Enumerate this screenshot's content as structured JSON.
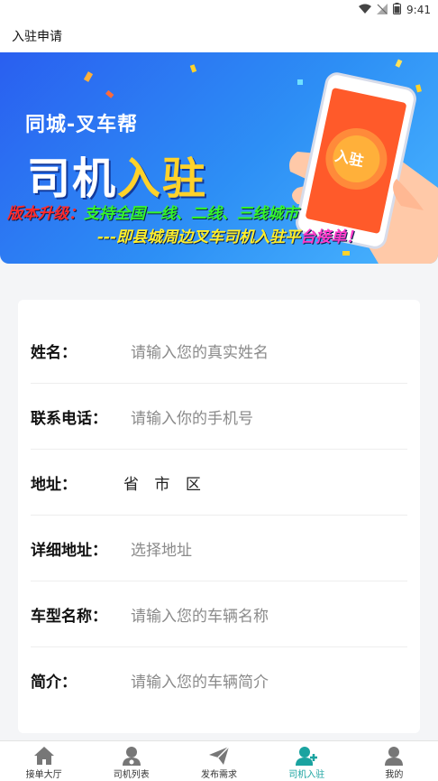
{
  "status_bar": {
    "time": "9:41"
  },
  "header": {
    "title": "入驻申请"
  },
  "banner": {
    "subtitle": "同城-叉车帮",
    "title_part1": "司机",
    "title_part2": "入驻",
    "line1_part1": "版本升级：",
    "line1_part2": "支持全国一线、二线、三线城市",
    "line2_part1": "---即县城周边叉车司机入驻平",
    "line2_part2": "台接单！",
    "phone_badge": "入驻"
  },
  "form": {
    "name": {
      "label": "姓名：",
      "placeholder": "请输入您的真实姓名"
    },
    "phone": {
      "label": "联系电话：",
      "placeholder": "请输入你的手机号"
    },
    "address": {
      "label": "地址：",
      "province": "省",
      "city": "市",
      "district": "区"
    },
    "detail_address": {
      "label": "详细地址：",
      "placeholder": "选择地址"
    },
    "vehicle_model": {
      "label": "车型名称：",
      "placeholder": "请输入您的车辆名称"
    },
    "intro": {
      "label": "简介：",
      "placeholder": "请输入您的车辆简介"
    }
  },
  "tabbar": {
    "items": [
      {
        "label": "接单大厅",
        "icon": "home-icon"
      },
      {
        "label": "司机列表",
        "icon": "driver-icon"
      },
      {
        "label": "发布需求",
        "icon": "send-icon"
      },
      {
        "label": "司机入驻",
        "icon": "add-driver-icon",
        "active": true
      },
      {
        "label": "我的",
        "icon": "profile-icon"
      }
    ],
    "active_color": "#1aa3a0"
  }
}
